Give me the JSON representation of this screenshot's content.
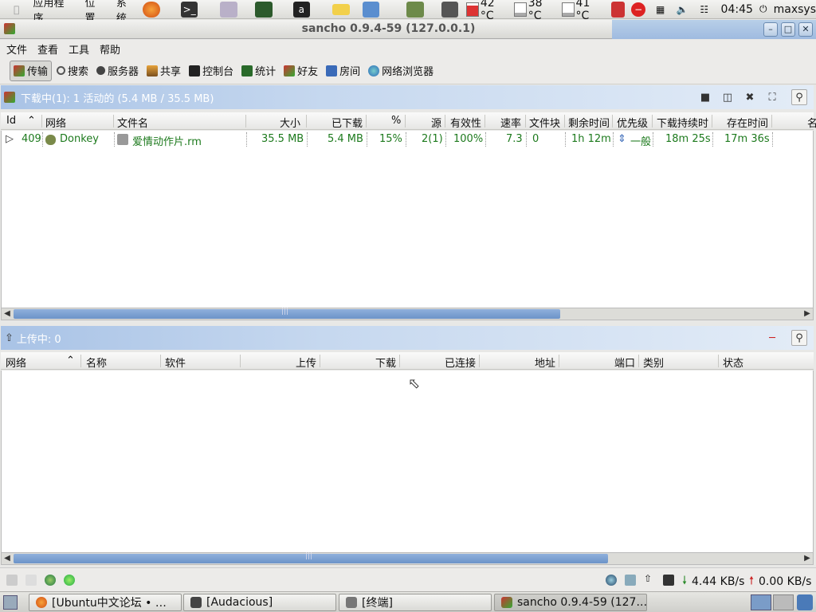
{
  "top_panel": {
    "menus": [
      "应用程序",
      "位置",
      "系统"
    ],
    "temps": [
      "42 °C",
      "38 °C",
      "41 °C"
    ],
    "clock": "04:45",
    "user": "maxsys"
  },
  "window": {
    "title": "sancho 0.9.4-59 (127.0.0.1)"
  },
  "menubar": [
    "文件",
    "查看",
    "工具",
    "帮助"
  ],
  "toolbar": [
    {
      "label": "传输",
      "icon": "transfer-icon"
    },
    {
      "label": "搜索",
      "icon": "search-icon"
    },
    {
      "label": "服务器",
      "icon": "server-icon"
    },
    {
      "label": "共享",
      "icon": "share-icon"
    },
    {
      "label": "控制台",
      "icon": "console-icon"
    },
    {
      "label": "统计",
      "icon": "stats-icon"
    },
    {
      "label": "好友",
      "icon": "friends-icon"
    },
    {
      "label": "房间",
      "icon": "room-icon"
    },
    {
      "label": "网络浏览器",
      "icon": "web-browser-icon"
    }
  ],
  "download_panel": {
    "header": "下载中(1): 1 活动的 (5.4 MB / 35.5 MB)",
    "columns": [
      "Id",
      "网络",
      "文件名",
      "大小",
      "已下载",
      "%",
      "源",
      "有效性",
      "速率",
      "文件块",
      "剩余时间",
      "优先级",
      "下载持续时",
      "存在时间",
      "名"
    ],
    "rows": [
      {
        "id": "409",
        "network": "Donkey",
        "filename": "爱情动作片.rm",
        "size": "35.5 MB",
        "downloaded": "5.4 MB",
        "percent": "15%",
        "sources": "2(1)",
        "availability": "100%",
        "rate": "7.3",
        "chunks": "0",
        "eta": "1h 12m",
        "priority": "一般",
        "duration": "18m 25s",
        "age": "17m 36s"
      }
    ]
  },
  "upload_panel": {
    "header": "上传中: 0",
    "columns": [
      "网络",
      "名称",
      "软件",
      "上传",
      "下载",
      "已连接",
      "地址",
      "端口",
      "类别",
      "状态"
    ]
  },
  "status": {
    "down_rate": "4.44 KB/s",
    "up_rate": "0.00 KB/s"
  },
  "taskbar": [
    {
      "label": "[Ubuntu中文论坛 • …",
      "icon": "firefox-icon"
    },
    {
      "label": "[Audacious]",
      "icon": "audacious-icon"
    },
    {
      "label": "[终端]",
      "icon": "terminal-icon"
    },
    {
      "label": "sancho 0.9.4-59 (127.…",
      "icon": "sancho-icon"
    }
  ],
  "colors": {
    "panel_header": "#a9c3e6",
    "row_text": "#1d7a1d",
    "scroll_thumb": "#7aa0d0"
  }
}
